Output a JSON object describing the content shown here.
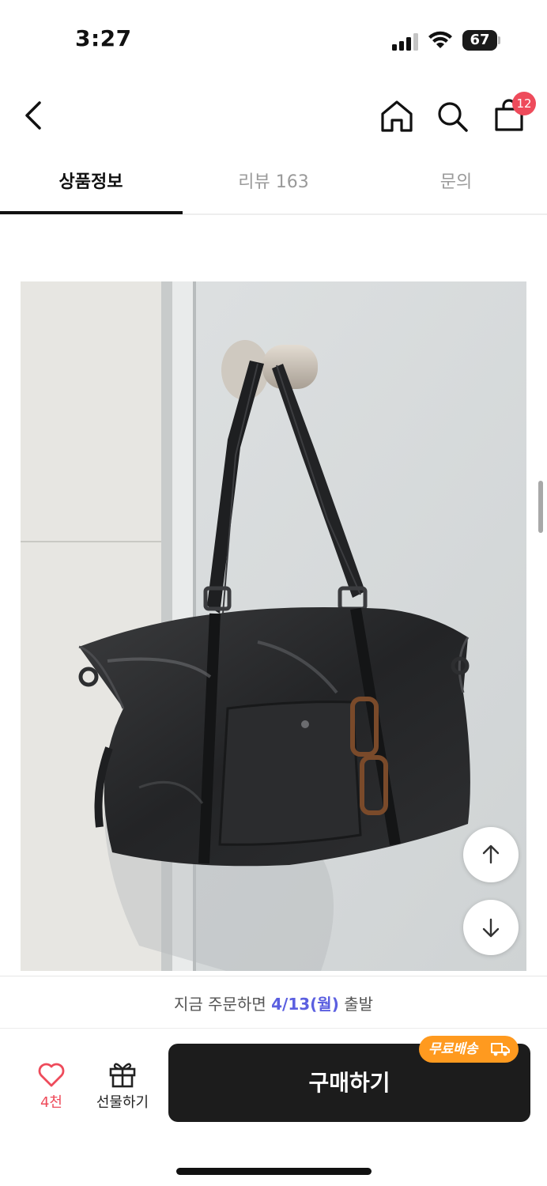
{
  "status_bar": {
    "time": "3:27",
    "battery": "67"
  },
  "nav": {
    "back_icon": "chevron-left-icon",
    "home_icon": "home-icon",
    "search_icon": "search-icon",
    "cart_icon": "shopping-bag-icon",
    "cart_badge": "12"
  },
  "tabs": [
    {
      "label": "상품정보",
      "active": true
    },
    {
      "label": "리뷰 163",
      "active": false
    },
    {
      "label": "문의",
      "active": false
    }
  ],
  "delivery": {
    "prefix": "지금 주문하면 ",
    "date": "4/13(월)",
    "suffix": " 출발"
  },
  "actions": {
    "like_count": "4천",
    "gift_label": "선물하기",
    "buy_label": "구매하기",
    "free_shipping_badge": "무료배송"
  },
  "colors": {
    "accent_red": "#ee4b5b",
    "delivery_date": "#5b5fe0",
    "badge_orange": "#ff9a1f",
    "buy_button": "#1c1c1c"
  }
}
